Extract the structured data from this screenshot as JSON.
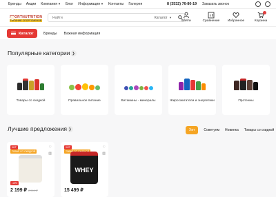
{
  "topbar": {
    "links": [
      "Бренды",
      "Акции",
      "Компания",
      "Блог",
      "Информация",
      "Контакты",
      "Галерея"
    ],
    "phone": "8 (3532) 76-80-19",
    "callback": "Заказать звонок"
  },
  "header": {
    "logo_line1": "SPORTNUTRITION",
    "logo_line2": "ПИТАНИЕ СПОРТСМЕНОВ",
    "search_placeholder": "Найти",
    "search_category": "Каталог",
    "icons": [
      {
        "label": "Войти",
        "icon": "user-icon"
      },
      {
        "label": "Сравнение",
        "icon": "compare-icon"
      },
      {
        "label": "Избранное",
        "icon": "heart-icon"
      },
      {
        "label": "Корзина",
        "icon": "cart-icon"
      }
    ]
  },
  "nav": {
    "catalog": "Каталог",
    "links": [
      "Бренды",
      "Важная информация"
    ]
  },
  "categories": {
    "title": "Популярные категории",
    "items": [
      {
        "label": "Товары со скидкой"
      },
      {
        "label": "Правильное питание"
      },
      {
        "label": "Витамины - минералы"
      },
      {
        "label": "Жиросжигатели и энергетики"
      },
      {
        "label": "Протеины"
      }
    ]
  },
  "offers": {
    "title": "Лучшие предложения",
    "tabs": [
      "Хит",
      "Советуем",
      "Новинка",
      "Товары со скидкой"
    ],
    "active_tab": "Хит",
    "products": [
      {
        "badge1": "ХИТ",
        "badge2": "ТОВАР СО СКИДКОЙ",
        "discount": "-15%",
        "price": "2 199 ₽",
        "old_price": "2 599 ₽"
      },
      {
        "badge1": "ХИТ",
        "badge2": "ТОВАР СО СКИДКОЙ",
        "brand": "WHEY",
        "price": "15 499 ₽"
      }
    ]
  },
  "colors": {
    "accent_red": "#e53935",
    "accent_orange": "#f5a524"
  }
}
